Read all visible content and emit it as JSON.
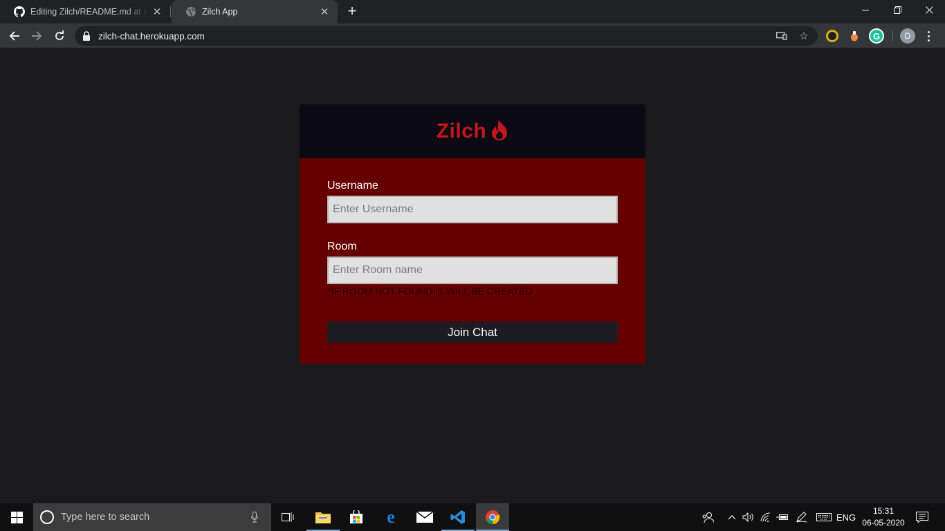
{
  "browser": {
    "tabs": [
      {
        "title": "Editing Zilch/README.md at master · Zilch",
        "active": false
      },
      {
        "title": "Zilch App",
        "active": true
      }
    ],
    "new_tab_label": "+",
    "window_controls": {
      "minimize": "—",
      "restore": "❐",
      "close": "✕"
    },
    "url": "zilch-chat.herokuapp.com",
    "profile_initial": "D"
  },
  "app": {
    "brand": "Zilch",
    "brand_color": "#c4161c",
    "form": {
      "username_label": "Username",
      "username_placeholder": "Enter Username",
      "room_label": "Room",
      "room_placeholder": "Enter Room name",
      "room_hint": "*IF ROOM NOT FOUND IT WILL BE CREATED",
      "join_label": "Join Chat"
    },
    "colors": {
      "header": "#0b0a14",
      "body": "#660000",
      "button": "#1d1c22"
    }
  },
  "taskbar": {
    "search_placeholder": "Type here to search",
    "language": "ENG",
    "time": "15:31",
    "date": "06-05-2020",
    "pinned": [
      "task-view-icon",
      "file-explorer-icon",
      "microsoft-store-icon",
      "edge-icon",
      "mail-icon",
      "vscode-icon",
      "chrome-icon"
    ]
  }
}
